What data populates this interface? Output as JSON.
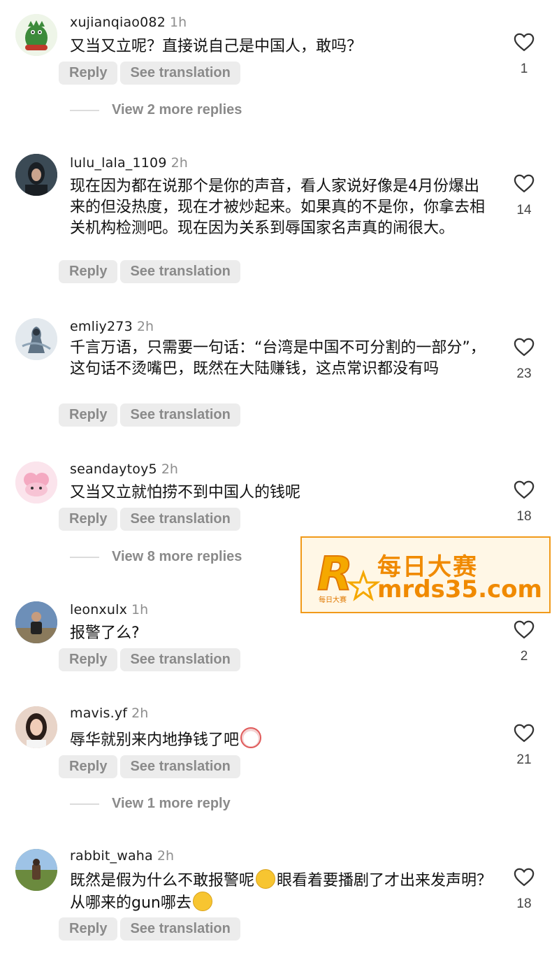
{
  "labels": {
    "reply": "Reply",
    "see_translation": "See translation"
  },
  "comments": [
    {
      "username": "xujianqiao082",
      "time": "1h",
      "text": "又当又立呢？直接说自己是中国人，敢吗？",
      "likes": "1",
      "more_replies": "View 2 more replies",
      "avatar": {
        "color": "#3c8a3a",
        "icon": "green-dinosaur-avatar"
      }
    },
    {
      "username": "lulu_lala_1109",
      "time": "2h",
      "text": "现在因为都在说那个是你的声音，看人家说好像是4月份爆出来的但没热度，现在才被炒起来。如果真的不是你，你拿去相关机构检测吧。现在因为关系到辱国家名声真的闹很大。",
      "likes": "14",
      "avatar": {
        "color": "#2f3b44",
        "icon": "portrait-avatar"
      }
    },
    {
      "username": "emliy273",
      "time": "2h",
      "text": "千言万语，只需要一句话：“台湾是中国不可分割的一部分”，这句话不烫嘴巴，既然在大陆赚钱，这点常识都没有吗",
      "likes": "23",
      "avatar": {
        "color": "#8fa4b6",
        "icon": "ink-painting-avatar"
      }
    },
    {
      "username": "seandaytoy5",
      "time": "2h",
      "text": "又当又立就怕捞不到中国人的钱呢",
      "likes": "18",
      "more_replies": "View 8 more replies",
      "avatar": {
        "color": "#f3c6d6",
        "icon": "pink-cartoon-avatar"
      }
    },
    {
      "username": "leonxulx",
      "time": "1h",
      "text": "报警了么?",
      "likes": "2",
      "avatar": {
        "color": "#4a6fa0",
        "icon": "person-photo-avatar"
      }
    },
    {
      "username": "mavis.yf",
      "time": "2h",
      "text": "辱华就别来内地挣钱了吧",
      "emoji_after": "clown-face-emoji",
      "likes": "21",
      "more_replies": "View 1 more reply",
      "avatar": {
        "color": "#d9b9a8",
        "icon": "woman-photo-avatar"
      }
    },
    {
      "username": "rabbit_waha",
      "time": "2h",
      "text_part1": "既然是假为什么不敢报警呢",
      "emoji1": "rolling-laughing-emoji",
      "text_part2": "眼看着要播剧了才出来发声明？从哪来的gun哪去",
      "emoji2": "kissing-face-emoji",
      "likes": "18",
      "avatar": {
        "color": "#7a8f5b",
        "icon": "landscape-avatar"
      }
    }
  ],
  "watermark": {
    "line1": "每日大赛",
    "line2": "mrds35.com",
    "logo_text": "每日大赛",
    "logo_letter": "R",
    "color": "#f08a00"
  }
}
